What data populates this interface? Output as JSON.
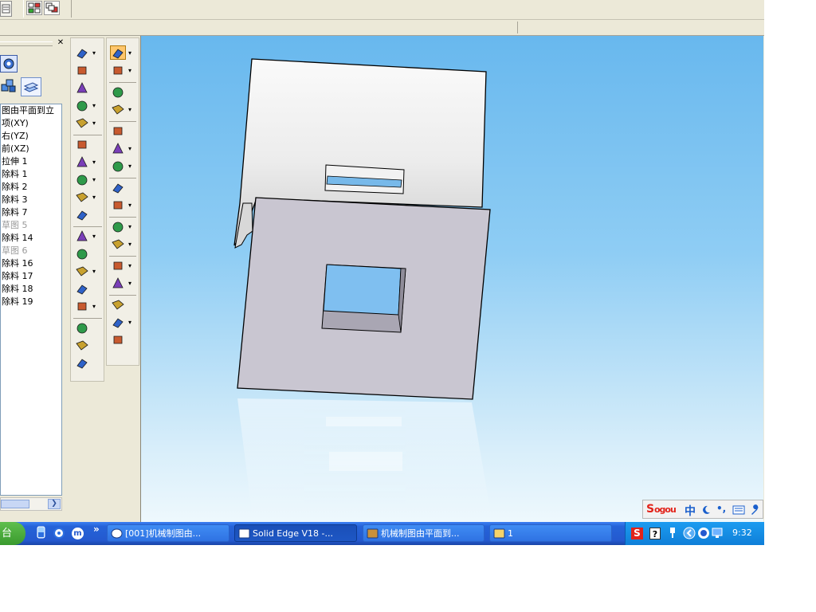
{
  "feature_tree": {
    "items": [
      {
        "label": "图由平面到立",
        "dimmed": false
      },
      {
        "label": "项(XY)",
        "dimmed": false
      },
      {
        "label": "右(YZ)",
        "dimmed": false
      },
      {
        "label": "前(XZ)",
        "dimmed": false
      },
      {
        "label": "拉伸 1",
        "dimmed": false
      },
      {
        "label": "除料 1",
        "dimmed": false
      },
      {
        "label": "除料 2",
        "dimmed": false
      },
      {
        "label": "除料 3",
        "dimmed": false
      },
      {
        "label": "除料 7",
        "dimmed": false
      },
      {
        "label": "草图 5",
        "dimmed": true
      },
      {
        "label": "除料 14",
        "dimmed": false
      },
      {
        "label": "草图 6",
        "dimmed": true
      },
      {
        "label": "除料 16",
        "dimmed": false
      },
      {
        "label": "除料 17",
        "dimmed": false
      },
      {
        "label": "除料 18",
        "dimmed": false
      },
      {
        "label": "除料 19",
        "dimmed": false
      }
    ],
    "close_glyph": "✕",
    "scroll_right_glyph": "❯"
  },
  "taskbar": {
    "start_label": "台",
    "overflow_glyph": "»",
    "quicklaunch_m": "m",
    "tasks": [
      {
        "label": "[001]机械制图由...",
        "icon": "ie-m-icon",
        "active": false
      },
      {
        "label": "Solid Edge V18 -...",
        "icon": "solid-edge-icon",
        "active": true
      },
      {
        "label": "机械制图由平面到...",
        "icon": "document-icon",
        "active": false
      },
      {
        "label": "1",
        "icon": "folder-icon",
        "active": false
      }
    ],
    "clock": "9:32",
    "tray_s": "S",
    "tray_help": "?"
  },
  "ime_bar": {
    "logo_s": "S",
    "logo_rest": "ogou",
    "mode": "中",
    "punct": "•,"
  },
  "colors": {
    "viewport_top": "#68b8ee",
    "taskbar_blue": "#2459cf",
    "tray_blue": "#0f7fd8",
    "panel_face": "#c9c6d1"
  }
}
